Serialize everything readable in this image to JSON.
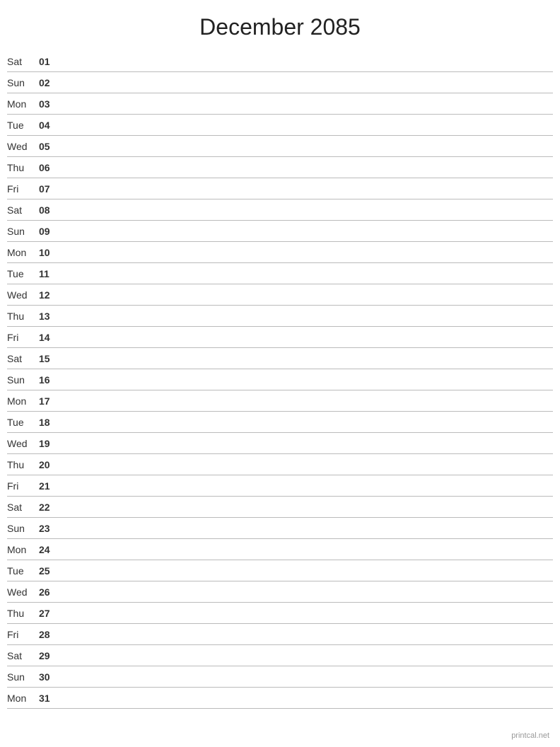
{
  "header": {
    "title": "December 2085"
  },
  "days": [
    {
      "name": "Sat",
      "number": "01"
    },
    {
      "name": "Sun",
      "number": "02"
    },
    {
      "name": "Mon",
      "number": "03"
    },
    {
      "name": "Tue",
      "number": "04"
    },
    {
      "name": "Wed",
      "number": "05"
    },
    {
      "name": "Thu",
      "number": "06"
    },
    {
      "name": "Fri",
      "number": "07"
    },
    {
      "name": "Sat",
      "number": "08"
    },
    {
      "name": "Sun",
      "number": "09"
    },
    {
      "name": "Mon",
      "number": "10"
    },
    {
      "name": "Tue",
      "number": "11"
    },
    {
      "name": "Wed",
      "number": "12"
    },
    {
      "name": "Thu",
      "number": "13"
    },
    {
      "name": "Fri",
      "number": "14"
    },
    {
      "name": "Sat",
      "number": "15"
    },
    {
      "name": "Sun",
      "number": "16"
    },
    {
      "name": "Mon",
      "number": "17"
    },
    {
      "name": "Tue",
      "number": "18"
    },
    {
      "name": "Wed",
      "number": "19"
    },
    {
      "name": "Thu",
      "number": "20"
    },
    {
      "name": "Fri",
      "number": "21"
    },
    {
      "name": "Sat",
      "number": "22"
    },
    {
      "name": "Sun",
      "number": "23"
    },
    {
      "name": "Mon",
      "number": "24"
    },
    {
      "name": "Tue",
      "number": "25"
    },
    {
      "name": "Wed",
      "number": "26"
    },
    {
      "name": "Thu",
      "number": "27"
    },
    {
      "name": "Fri",
      "number": "28"
    },
    {
      "name": "Sat",
      "number": "29"
    },
    {
      "name": "Sun",
      "number": "30"
    },
    {
      "name": "Mon",
      "number": "31"
    }
  ],
  "footer": {
    "text": "printcal.net"
  }
}
